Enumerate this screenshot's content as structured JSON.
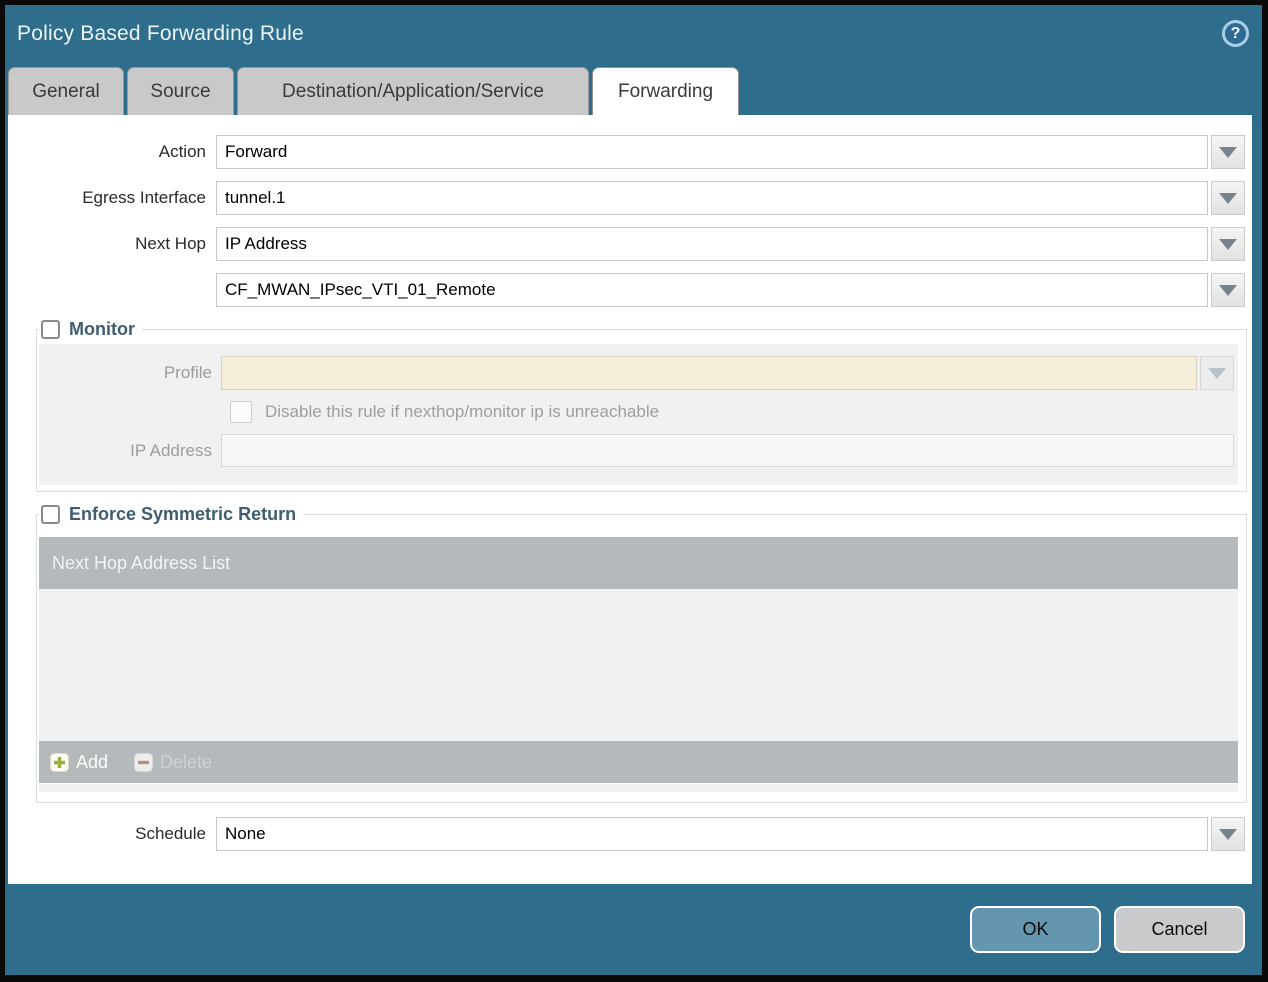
{
  "dialog": {
    "title": "Policy Based Forwarding Rule",
    "help_icon_glyph": "?"
  },
  "tabs": [
    {
      "label": "General",
      "active": false
    },
    {
      "label": "Source",
      "active": false
    },
    {
      "label": "Destination/Application/Service",
      "active": false
    },
    {
      "label": "Forwarding",
      "active": true
    }
  ],
  "form": {
    "action": {
      "label": "Action",
      "value": "Forward"
    },
    "egress_interface": {
      "label": "Egress Interface",
      "value": "tunnel.1"
    },
    "next_hop": {
      "label": "Next Hop",
      "type_value": "IP Address",
      "address_value": "CF_MWAN_IPsec_VTI_01_Remote"
    },
    "schedule": {
      "label": "Schedule",
      "value": "None"
    }
  },
  "monitor": {
    "legend": "Monitor",
    "checked": false,
    "profile_label": "Profile",
    "profile_value": "",
    "disable_checkbox_label": "Disable this rule if nexthop/monitor ip is unreachable",
    "disable_checkbox_checked": false,
    "ip_address_label": "IP Address",
    "ip_address_value": ""
  },
  "enforce_symmetric_return": {
    "legend": "Enforce Symmetric Return",
    "checked": false,
    "table": {
      "header": "Next Hop Address List",
      "rows": [],
      "add_label": "Add",
      "delete_label": "Delete",
      "delete_enabled": false
    }
  },
  "footer": {
    "ok_label": "OK",
    "cancel_label": "Cancel"
  },
  "colors": {
    "chrome": "#2e6d8c",
    "ok_button": "#6496af",
    "cancel_button": "#c8cacc",
    "disabled_field_beige": "#f5eedb",
    "table_bar_gray": "#b4b9bb",
    "add_icon_green": "#97b13d",
    "delete_icon_red": "#b78d80"
  }
}
